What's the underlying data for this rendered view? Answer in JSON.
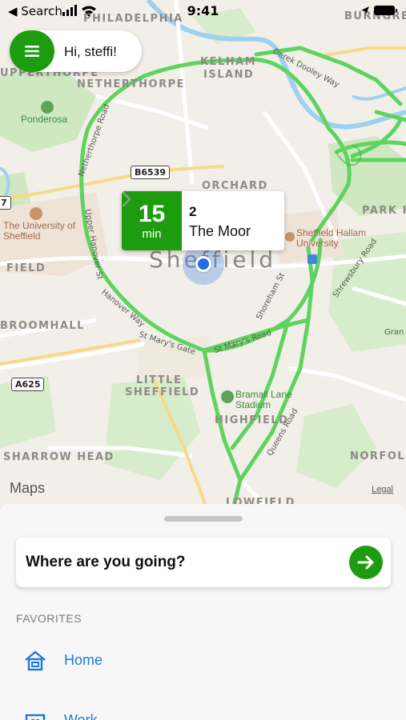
{
  "status_bar": {
    "back_label": "◀ Search",
    "time": "9:41"
  },
  "menu": {
    "greeting": "Hi, steffi!"
  },
  "departure": {
    "minutes": "15",
    "unit": "min",
    "line": "2",
    "stop": "The Moor"
  },
  "map": {
    "district_labels": [
      "PHILADELPHIA",
      "BURNGREA",
      "KELHAM",
      "ISLAND",
      "UPPERTHORPE",
      "NETHERTHORPE",
      "ORCHARD",
      "PARK H",
      "FIELD",
      "BROOMHALL",
      "LITTLE",
      "SHEFFIELD",
      "HIGHFIELD",
      "SHARROW HEAD",
      "NORFOLK",
      "LOWFIELD"
    ],
    "city_label": "Sheffield",
    "pois": {
      "ponderosa": "Ponderosa",
      "uni_sheffield": "The University of Sheffield",
      "hallam": "Sheffield Hallam University",
      "bramall": "Bramall Lane Stadium"
    },
    "roads": {
      "b6539": "B6539",
      "a625": "A625",
      "seven": "7",
      "derek_dooley": "Derek Dooley Way",
      "netherthorpe_rd": "Netherthorpe Road",
      "upper_hanover": "Upper Hanover St",
      "hanover_way": "Hanover Way",
      "st_marys_gate": "St Mary's Gate",
      "st_marys_road": "St Mary's Road",
      "shoreham": "Shoreham St",
      "shrewsbury": "Shrewsbury Road",
      "queens": "Queens Road",
      "gran": "Gran"
    },
    "attribution": "Maps",
    "legal": "Legal"
  },
  "sheet": {
    "search_placeholder": "Where are you going?",
    "favorites_header": "FAVORITES",
    "favorites": [
      {
        "label": "Home",
        "icon": "home-icon"
      },
      {
        "label": "Work",
        "icon": "work-icon"
      }
    ]
  },
  "colors": {
    "brand_green": "#1e9c0f",
    "route_green": "#5fd35f",
    "link_blue": "#1e78d6"
  }
}
